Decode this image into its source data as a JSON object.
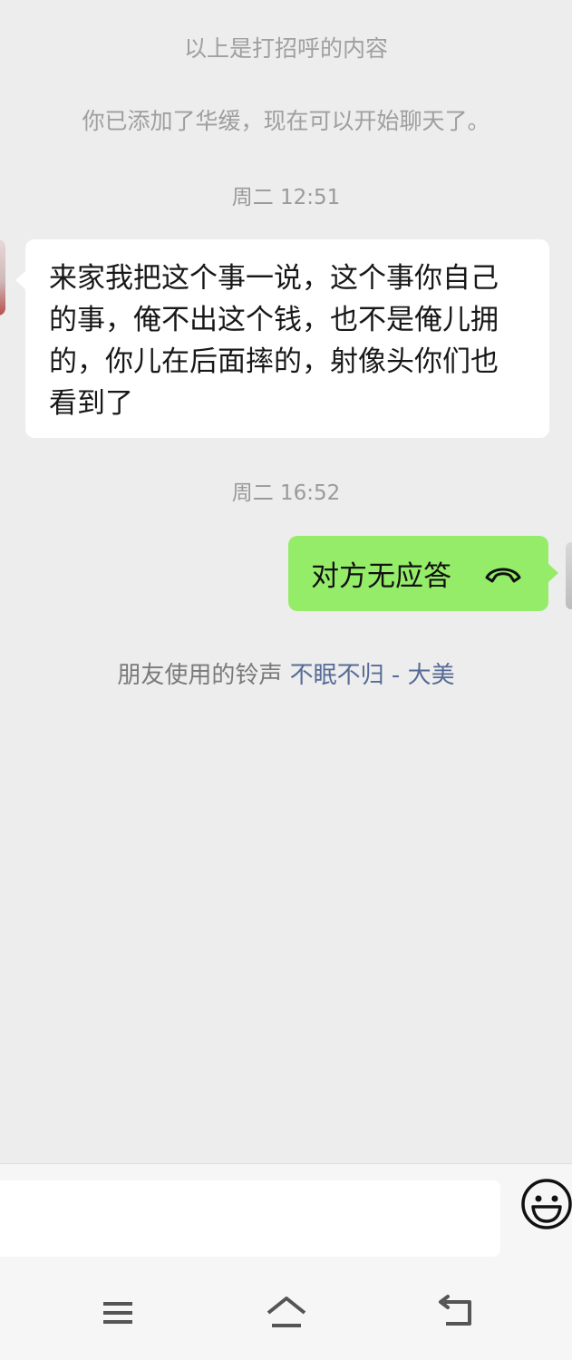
{
  "chat": {
    "system_greeting": "以上是打招呼的内容",
    "system_added": "你已添加了华缓，现在可以开始聊天了。",
    "timestamp_1": "周二 12:51",
    "incoming_message": "来家我把这个事一说，这个事你自己的事，俺不出这个钱，也不是俺儿拥的，你儿在后面摔的，射像头你们也看到了",
    "timestamp_2": "周二 16:52",
    "outgoing_call_status": "对方无应答",
    "ringtone_prefix": "朋友使用的铃声",
    "ringtone_song": "不眠不归 - 大美"
  },
  "input_bar": {
    "placeholder": ""
  },
  "icons": {
    "hangup": "phone-hangup-icon",
    "emoji": "smiley-face-icon",
    "menu": "menu-icon",
    "home": "home-icon",
    "back": "back-icon"
  },
  "colors": {
    "background": "#ededed",
    "incoming_bubble": "#ffffff",
    "outgoing_bubble": "#95ec69",
    "link": "#576b95",
    "system_text": "#9f9f9f"
  }
}
